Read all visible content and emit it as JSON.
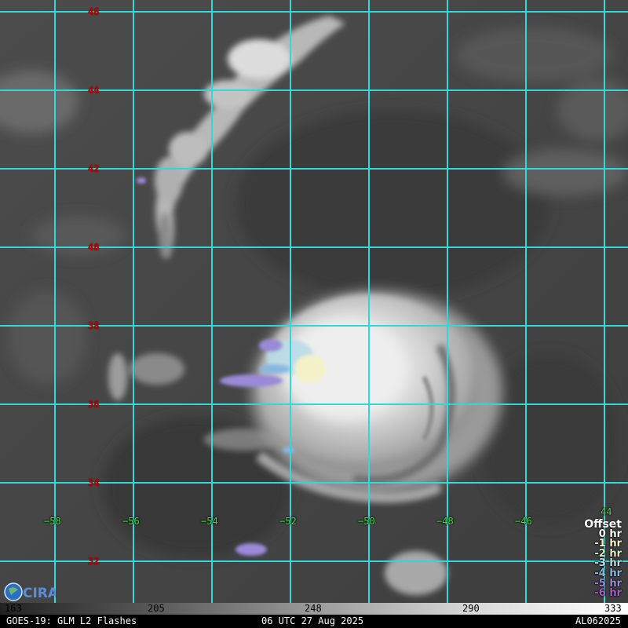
{
  "grid": {
    "lat_labels": [
      "46",
      "44",
      "42",
      "40",
      "38",
      "36",
      "34",
      "32"
    ],
    "lon_labels": [
      "−58",
      "−56",
      "−54",
      "−52",
      "−50",
      "−48",
      "−46",
      "44"
    ],
    "grid_color": "#30d8d8",
    "lat_label_color": "#c00000",
    "lon_label_color": "#3ee03e"
  },
  "legend": {
    "title": "Offset",
    "entries": [
      {
        "label": "0 hr",
        "color": "#ffffff"
      },
      {
        "label": "-1 hr",
        "color": "#f4f1c8"
      },
      {
        "label": "-2 hr",
        "color": "#d8e8c8"
      },
      {
        "label": "-3 hr",
        "color": "#b8dce8"
      },
      {
        "label": "-4 hr",
        "color": "#88b8e0"
      },
      {
        "label": "-5 hr",
        "color": "#9a8ad8"
      },
      {
        "label": "-6 hr",
        "color": "#a060c0"
      }
    ]
  },
  "logo": {
    "text": "CIRA"
  },
  "colorbar": {
    "ticks": [
      "163",
      "205",
      "248",
      "290",
      "333"
    ]
  },
  "footer": {
    "left": "GOES-19: GLM L2 Flashes",
    "center": "06 UTC 27 Aug 2025",
    "right": "AL062025"
  }
}
